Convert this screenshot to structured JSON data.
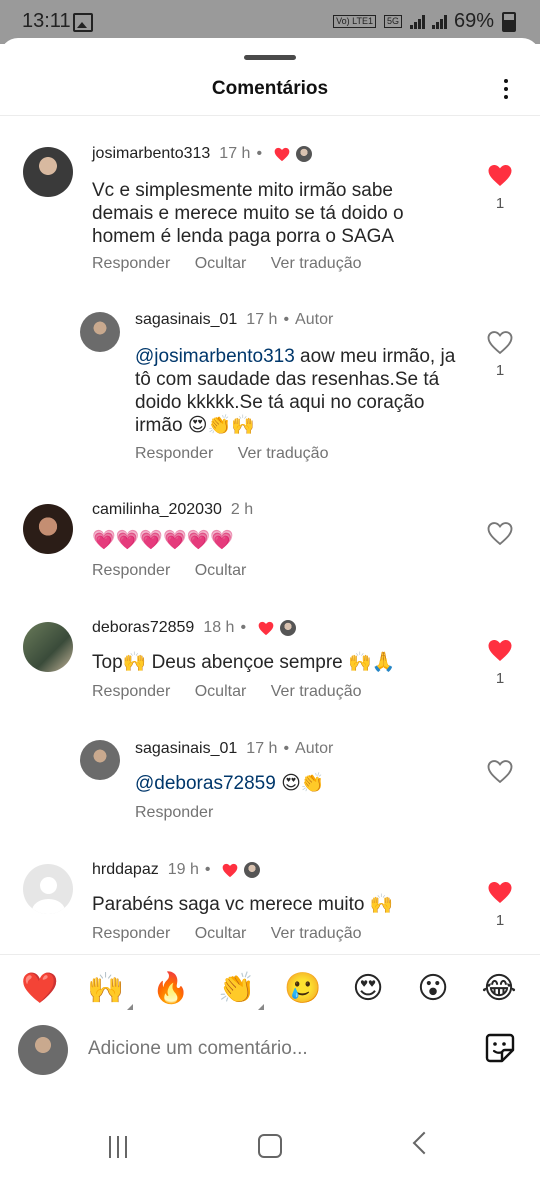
{
  "status_bar": {
    "time": "13:11",
    "network_tag": "Vo) LTE1",
    "signal_tag": "5G",
    "battery": "69%"
  },
  "header": {
    "title": "Comentários"
  },
  "comments": [
    {
      "username": "josimarbento313",
      "time": "17 h",
      "text": "Vc e simplesmente mito irmão sabe demais e merece muito se tá doido o homem é lenda paga porra o SAGA",
      "actions": [
        "Responder",
        "Ocultar",
        "Ver tradução"
      ],
      "liked": true,
      "like_count": "1"
    },
    {
      "username": "sagasinais_01",
      "time": "17 h",
      "author_label": "Autor",
      "mention": "@josimarbento313",
      "text": " aow meu irmão, ja tô com saudade das resenhas.Se tá doido kkkkk.Se tá aqui no coração irmão 😍👏🙌",
      "actions": [
        "Responder",
        "Ver tradução"
      ],
      "liked": false,
      "like_count": "1"
    },
    {
      "username": "camilinha_202030",
      "time": "2 h",
      "text": "💗💗💗💗💗💗",
      "actions": [
        "Responder",
        "Ocultar"
      ],
      "liked": false
    },
    {
      "username": "deboras72859",
      "time": "18 h",
      "text": "Top🙌 Deus abençoe sempre 🙌🙏",
      "actions": [
        "Responder",
        "Ocultar",
        "Ver tradução"
      ],
      "liked": true,
      "like_count": "1"
    },
    {
      "username": "sagasinais_01",
      "time": "17 h",
      "author_label": "Autor",
      "mention": "@deboras72859",
      "text": " 😍👏",
      "actions": [
        "Responder"
      ],
      "liked": false
    },
    {
      "username": "hrddapaz",
      "time": "19 h",
      "text": "Parabéns saga vc merece muito 🙌",
      "actions": [
        "Responder",
        "Ocultar",
        "Ver tradução"
      ],
      "liked": true,
      "like_count": "1"
    }
  ],
  "reactions": [
    "❤️",
    "🙌",
    "🔥",
    "👏",
    "🥲",
    "😍",
    "😮",
    "😂"
  ],
  "input": {
    "placeholder": "Adicione um comentário..."
  },
  "colors": {
    "like_red": "#ff3040",
    "mention_blue": "#00376b",
    "muted_text": "#737373"
  }
}
